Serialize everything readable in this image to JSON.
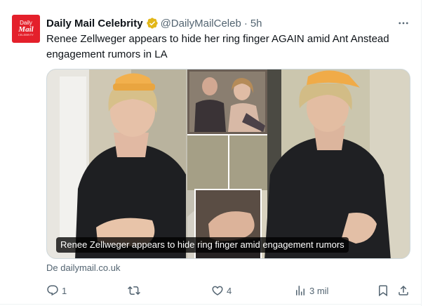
{
  "tweet": {
    "author": {
      "display_name": "Daily Mail Celebrity",
      "handle": "@DailyMailCeleb",
      "separator": "·",
      "time": "5h",
      "verified": true,
      "avatar": {
        "line1": "Daily",
        "line2": "Mail",
        "line3": "CELEBRITY"
      }
    },
    "more_icon": "more-horizontal-icon",
    "text": "Renee Zellweger appears to hide her ring finger AGAIN amid Ant Anstead engagement rumors in LA",
    "card": {
      "caption": "Renee Zellweger appears to hide ring finger amid engagement rumors",
      "source": "De dailymail.co.uk"
    },
    "actions": {
      "reply": {
        "icon": "reply-icon",
        "count": "1"
      },
      "retweet": {
        "icon": "retweet-icon",
        "count": ""
      },
      "like": {
        "icon": "heart-icon",
        "count": "4"
      },
      "views": {
        "icon": "views-chart-icon",
        "count": "3 mil"
      },
      "bookmark": {
        "icon": "bookmark-icon"
      },
      "share": {
        "icon": "share-icon"
      }
    }
  },
  "colors": {
    "text_primary": "#0f1419",
    "text_secondary": "#536471",
    "avatar_red": "#e4202b",
    "verified_gold": "#e2b719",
    "border": "#cfd9de"
  }
}
